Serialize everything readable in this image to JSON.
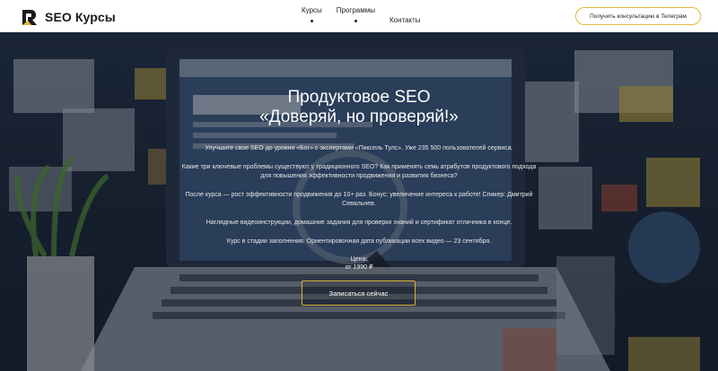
{
  "header": {
    "logo_text": "SEO Курсы",
    "nav": [
      {
        "label": "Курсы",
        "has_dropdown": true
      },
      {
        "label": "Программы",
        "has_dropdown": true
      },
      {
        "label": "Контакты",
        "has_dropdown": false
      }
    ],
    "consult_button": "Получить консультацию в Телеграм"
  },
  "hero": {
    "title_line1": "Продуктовое SEO",
    "title_line2": "«Доверяй, но проверяй!»",
    "paragraphs": [
      "Улучшите свое SEO до уровня «Бог» с экспертами «Пиксель Тулс». Уже 235 500 пользователей сервиса.",
      "Какие три ключевые проблемы существуют у традиционного SEO? Как применять семь атрибутов продуктового подхода для повышения эффективности продвижения и развития бизнеса?",
      "После курса — рост эффективности продвижения до 10+ раз. Бонус: увеличение интереса к работе! Спикер: Дмитрий Севальнев.",
      "Наглядные видеоинструкции, домашние задания для проверки знаний и сертификат отличника в конце.",
      "Курс в стадии заполнения. Ориентировочная дата публикации всех видео — 23 сентября."
    ],
    "price_label": "Цена:",
    "price_value": "от 1990 ₽",
    "cta": "Записаться сейчас"
  },
  "colors": {
    "accent": "#e0b93a",
    "header_bg": "#ffffff",
    "hero_bg": "#1f2a3a"
  }
}
